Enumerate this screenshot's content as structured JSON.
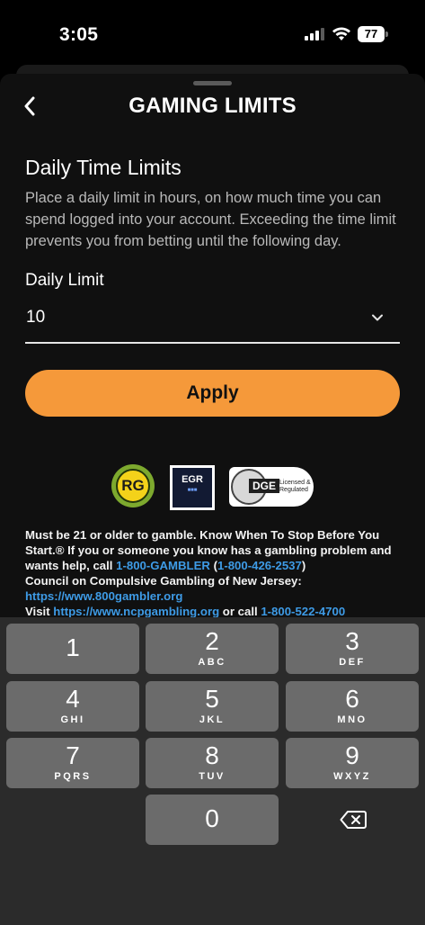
{
  "status_bar": {
    "time": "3:05",
    "battery": "77",
    "icons": [
      "signal-icon",
      "wifi-icon",
      "battery-icon"
    ]
  },
  "header": {
    "title": "GAMING LIMITS",
    "back_icon": "chevron-left-icon"
  },
  "section": {
    "title": "Daily Time Limits",
    "description": "Place a daily limit in hours, on how much time you can spend logged into your account. Exceeding the time limit prevents you from betting until the following day."
  },
  "daily_limit": {
    "label": "Daily Limit",
    "value": "10"
  },
  "apply_label": "Apply",
  "logos": {
    "rg": "RG",
    "egr": "EGR",
    "dge": "DGE",
    "dge_sub": "Licensed & Regulated"
  },
  "disclaimer": {
    "line1": "Must be 21 or older to gamble. Know When To Stop Before You Start.® If you or someone you know has a gambling problem and wants help, call ",
    "phone1": "1-800-GAMBLER",
    "paren_open": " (",
    "phone1_num": "1-800-426-2537",
    "paren_close": ")",
    "council": "Council on Compulsive Gambling of New Jersey: ",
    "council_url": "https://www.800gambler.org",
    "visit": "Visit ",
    "visit_url": "https://www.ncpgambling.org",
    "or_call": " or call ",
    "phone2": "1-800-522-4700"
  },
  "keypad": {
    "keys": [
      {
        "digit": "1",
        "letters": ""
      },
      {
        "digit": "2",
        "letters": "ABC"
      },
      {
        "digit": "3",
        "letters": "DEF"
      },
      {
        "digit": "4",
        "letters": "GHI"
      },
      {
        "digit": "5",
        "letters": "JKL"
      },
      {
        "digit": "6",
        "letters": "MNO"
      },
      {
        "digit": "7",
        "letters": "PQRS"
      },
      {
        "digit": "8",
        "letters": "TUV"
      },
      {
        "digit": "9",
        "letters": "WXYZ"
      },
      {
        "digit": "0",
        "letters": ""
      }
    ],
    "delete_icon": "delete-backspace-icon"
  },
  "colors": {
    "accent": "#f5993a",
    "link": "#3e9be6",
    "background": "#101010",
    "keyboard_bg": "#2b2b2b",
    "key_bg": "#6b6b6b"
  }
}
